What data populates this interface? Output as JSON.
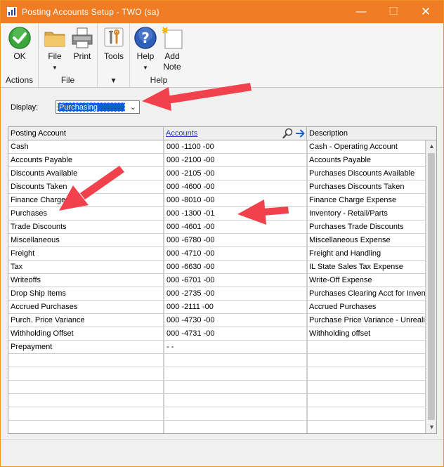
{
  "window": {
    "title": "Posting Accounts Setup  -  TWO (sa)",
    "controls": {
      "minimize": "—",
      "maximize": "☐",
      "close": "✕"
    }
  },
  "ribbon": {
    "groups": [
      {
        "label": "Actions",
        "buttons": [
          {
            "label": "OK"
          }
        ]
      },
      {
        "label": "File",
        "buttons": [
          {
            "label": "File"
          },
          {
            "label": "Print"
          }
        ]
      },
      {
        "label": "",
        "buttons": [
          {
            "label": "Tools"
          }
        ]
      },
      {
        "label": "Help",
        "buttons": [
          {
            "label": "Help"
          },
          {
            "label": "Add",
            "label2": "Note"
          }
        ]
      }
    ],
    "tools_group_caret": "▾"
  },
  "display": {
    "label": "Display:",
    "value": "Purchasing"
  },
  "grid": {
    "columns": [
      "Posting Account",
      "Accounts",
      "Description"
    ],
    "rows": [
      {
        "account": "Cash",
        "number": "000 -1100 -00",
        "description": "Cash - Operating Account"
      },
      {
        "account": "Accounts Payable",
        "number": "000 -2100 -00",
        "description": "Accounts Payable"
      },
      {
        "account": "Discounts Available",
        "number": "000 -2105 -00",
        "description": "Purchases Discounts Available"
      },
      {
        "account": "Discounts Taken",
        "number": "000 -4600 -00",
        "description": "Purchases Discounts Taken"
      },
      {
        "account": "Finance Charge",
        "number": "000 -8010 -00",
        "description": "Finance Charge Expense"
      },
      {
        "account": "Purchases",
        "number": "000 -1300 -01",
        "description": "Inventory - Retail/Parts"
      },
      {
        "account": "Trade Discounts",
        "number": "000 -4601 -00",
        "description": "Purchases Trade Discounts"
      },
      {
        "account": "Miscellaneous",
        "number": "000 -6780 -00",
        "description": "Miscellaneous Expense"
      },
      {
        "account": "Freight",
        "number": "000 -4710 -00",
        "description": "Freight and Handling"
      },
      {
        "account": "Tax",
        "number": "000 -6630 -00",
        "description": "IL State Sales Tax Expense"
      },
      {
        "account": "Writeoffs",
        "number": "000 -6701 -00",
        "description": "Write-Off Expense"
      },
      {
        "account": "Drop Ship Items",
        "number": "000 -2735 -00",
        "description": "Purchases Clearing Acct for Invent"
      },
      {
        "account": "Accrued Purchases",
        "number": "000 -2111 -00",
        "description": "Accrued Purchases"
      },
      {
        "account": "Purch. Price Variance",
        "number": "000 -4730 -00",
        "description": "Purchase Price Variance - Unrealiz"
      },
      {
        "account": "Withholding Offset",
        "number": "000 -4731 -00",
        "description": "Withholding offset"
      },
      {
        "account": "Prepayment",
        "number": "        -           -",
        "description": ""
      },
      {
        "account": "",
        "number": "",
        "description": ""
      },
      {
        "account": "",
        "number": "",
        "description": ""
      },
      {
        "account": "",
        "number": "",
        "description": ""
      },
      {
        "account": "",
        "number": "",
        "description": ""
      },
      {
        "account": "",
        "number": "",
        "description": ""
      },
      {
        "account": "",
        "number": "",
        "description": ""
      }
    ]
  },
  "scrollbar": {
    "up": "▲",
    "down": "▼"
  },
  "colors": {
    "titlebar": "#f07d23",
    "selection": "#0a5fd6",
    "link": "#2a3cc8",
    "annotation": "#f0414d"
  },
  "icons": [
    "app-icon",
    "ok-check-icon",
    "folder-icon",
    "printer-icon",
    "tools-icon",
    "help-icon",
    "note-icon",
    "lookup-icon",
    "expand-arrow-icon",
    "chevron-down-icon"
  ]
}
